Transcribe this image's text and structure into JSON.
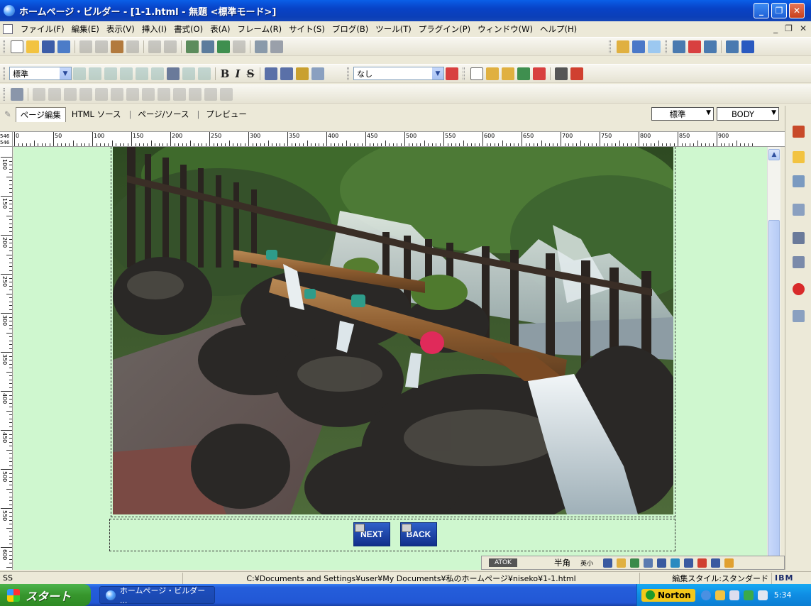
{
  "window": {
    "title": "ホームページ・ビルダー - [1-1.html - 無題 <標準モード>]",
    "minimize_glyph": "_",
    "maximize_glyph": "❐",
    "close_glyph": "✕"
  },
  "menu": {
    "items": [
      "ファイル(F)",
      "編集(E)",
      "表示(V)",
      "挿入(I)",
      "書式(O)",
      "表(A)",
      "フレーム(R)",
      "サイト(S)",
      "ブログ(B)",
      "ツール(T)",
      "プラグイン(P)",
      "ウィンドウ(W)",
      "ヘルプ(H)"
    ],
    "mdi_min": "_",
    "mdi_restore": "❐",
    "mdi_close": "✕"
  },
  "toolbar": {
    "style_value": "標準",
    "font_value": "なし",
    "bold": "B",
    "italic": "I",
    "strike": "S"
  },
  "view_tabs": {
    "items": [
      "ページ編集",
      "HTML ソース",
      "ページ/ソース",
      "プレビュー"
    ],
    "active": "ページ編集",
    "mode_select": "標準",
    "tag_select": "BODY"
  },
  "ruler": {
    "corner_top": "546",
    "corner_bottom": "546",
    "labels": [
      "0",
      "50",
      "100",
      "150",
      "200",
      "250",
      "300",
      "350",
      "400",
      "450",
      "500",
      "550",
      "600",
      "650",
      "700",
      "750",
      "800",
      "850",
      "900"
    ],
    "vlabels": [
      "100",
      "150",
      "200",
      "250",
      "300",
      "350",
      "400",
      "450",
      "500",
      "550",
      "600"
    ]
  },
  "canvas": {
    "background": "#CFF7CF",
    "next_button": "NEXT",
    "back_button": "BACK"
  },
  "ime": {
    "atok": "ATOK",
    "mode": "半角",
    "sub": "英小"
  },
  "statusbar": {
    "left": "SS",
    "path": "C:¥Documents and Settings¥user¥My Documents¥私のホームページ¥niseko¥1-1.html",
    "edit_style": "編集スタイル:スタンダード",
    "brand": "IBM"
  },
  "taskbar": {
    "start": "スタート",
    "task_item": "ホームページ・ビルダー ...",
    "norton": "Norton",
    "clock": "5:34"
  }
}
